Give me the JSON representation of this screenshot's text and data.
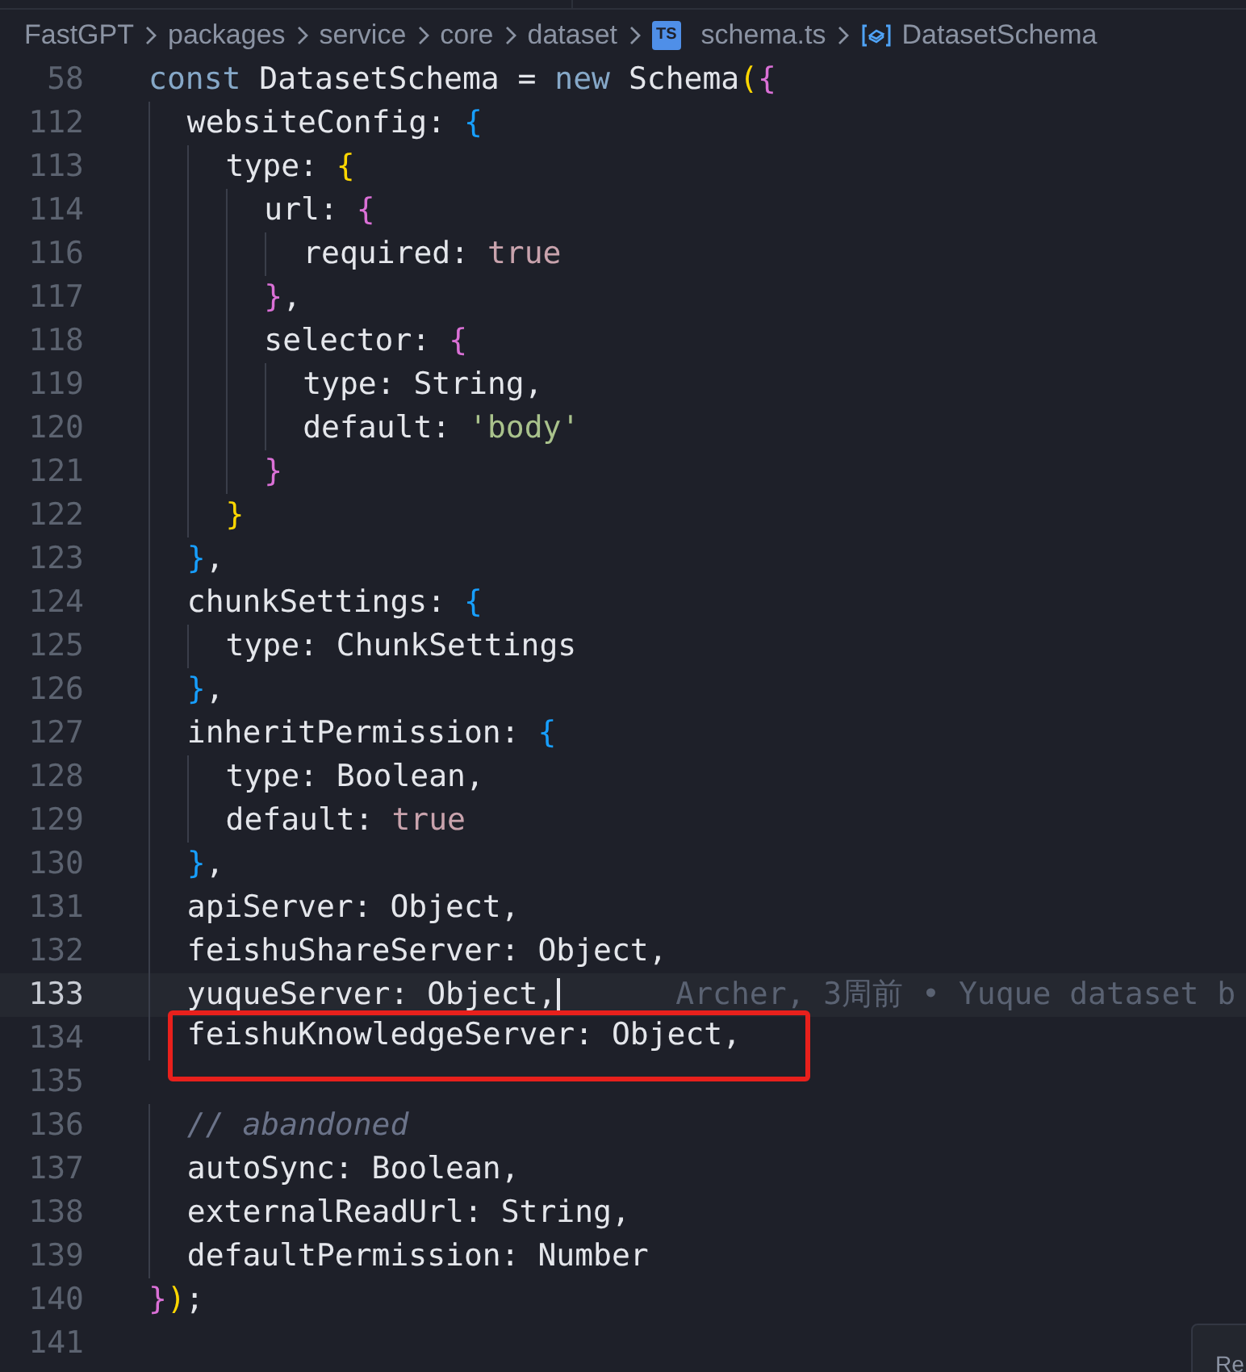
{
  "breadcrumb": [
    {
      "kind": "folder",
      "label": "FastGPT"
    },
    {
      "kind": "folder",
      "label": "packages"
    },
    {
      "kind": "folder",
      "label": "service"
    },
    {
      "kind": "folder",
      "label": "core"
    },
    {
      "kind": "folder",
      "label": "dataset"
    },
    {
      "kind": "file",
      "badge": "TS",
      "label": "schema.ts"
    },
    {
      "kind": "symbol",
      "label": "DatasetSchema"
    }
  ],
  "lines": [
    {
      "number": "58",
      "current": false,
      "highlighted": false,
      "tokens": [
        {
          "text": "const",
          "kind": "keyword"
        },
        {
          "text": " DatasetSchema = ",
          "kind": "plain"
        },
        {
          "text": "new",
          "kind": "keyword"
        },
        {
          "text": " Schema",
          "kind": "plain"
        },
        {
          "text": "(",
          "kind": "gold"
        },
        {
          "text": "{",
          "kind": "pink"
        }
      ]
    },
    {
      "number": "112",
      "current": false,
      "highlighted": false,
      "tokens": [
        {
          "text": "  websiteConfig: ",
          "kind": "plain"
        },
        {
          "text": "{",
          "kind": "blue"
        }
      ]
    },
    {
      "number": "113",
      "current": false,
      "highlighted": false,
      "tokens": [
        {
          "text": "    type: ",
          "kind": "plain"
        },
        {
          "text": "{",
          "kind": "gold"
        }
      ]
    },
    {
      "number": "114",
      "current": false,
      "highlighted": false,
      "tokens": [
        {
          "text": "      url: ",
          "kind": "plain"
        },
        {
          "text": "{",
          "kind": "pink"
        }
      ]
    },
    {
      "number": "116",
      "current": false,
      "highlighted": false,
      "tokens": [
        {
          "text": "        required: ",
          "kind": "plain"
        },
        {
          "text": "true",
          "kind": "literal"
        }
      ]
    },
    {
      "number": "117",
      "current": false,
      "highlighted": false,
      "tokens": [
        {
          "text": "      }",
          "kind": "pink"
        },
        {
          "text": ",",
          "kind": "plain"
        }
      ]
    },
    {
      "number": "118",
      "current": false,
      "highlighted": false,
      "tokens": [
        {
          "text": "      selector: ",
          "kind": "plain"
        },
        {
          "text": "{",
          "kind": "pink"
        }
      ]
    },
    {
      "number": "119",
      "current": false,
      "highlighted": false,
      "tokens": [
        {
          "text": "        type: String,",
          "kind": "plain"
        }
      ]
    },
    {
      "number": "120",
      "current": false,
      "highlighted": false,
      "tokens": [
        {
          "text": "        default: ",
          "kind": "plain"
        },
        {
          "text": "'body'",
          "kind": "string"
        }
      ]
    },
    {
      "number": "121",
      "current": false,
      "highlighted": false,
      "tokens": [
        {
          "text": "      }",
          "kind": "pink"
        }
      ]
    },
    {
      "number": "122",
      "current": false,
      "highlighted": false,
      "tokens": [
        {
          "text": "    }",
          "kind": "gold"
        }
      ]
    },
    {
      "number": "123",
      "current": false,
      "highlighted": false,
      "tokens": [
        {
          "text": "  }",
          "kind": "blue"
        },
        {
          "text": ",",
          "kind": "plain"
        }
      ]
    },
    {
      "number": "124",
      "current": false,
      "highlighted": false,
      "tokens": [
        {
          "text": "  chunkSettings: ",
          "kind": "plain"
        },
        {
          "text": "{",
          "kind": "blue"
        }
      ]
    },
    {
      "number": "125",
      "current": false,
      "highlighted": false,
      "tokens": [
        {
          "text": "    type: ChunkSettings",
          "kind": "plain"
        }
      ]
    },
    {
      "number": "126",
      "current": false,
      "highlighted": false,
      "tokens": [
        {
          "text": "  }",
          "kind": "blue"
        },
        {
          "text": ",",
          "kind": "plain"
        }
      ]
    },
    {
      "number": "127",
      "current": false,
      "highlighted": false,
      "tokens": [
        {
          "text": "  inheritPermission: ",
          "kind": "plain"
        },
        {
          "text": "{",
          "kind": "blue"
        }
      ]
    },
    {
      "number": "128",
      "current": false,
      "highlighted": false,
      "tokens": [
        {
          "text": "    type: Boolean,",
          "kind": "plain"
        }
      ]
    },
    {
      "number": "129",
      "current": false,
      "highlighted": false,
      "tokens": [
        {
          "text": "    default: ",
          "kind": "plain"
        },
        {
          "text": "true",
          "kind": "literal"
        }
      ]
    },
    {
      "number": "130",
      "current": false,
      "highlighted": false,
      "tokens": [
        {
          "text": "  }",
          "kind": "blue"
        },
        {
          "text": ",",
          "kind": "plain"
        }
      ]
    },
    {
      "number": "131",
      "current": false,
      "highlighted": false,
      "tokens": [
        {
          "text": "  apiServer: Object,",
          "kind": "plain"
        }
      ]
    },
    {
      "number": "132",
      "current": false,
      "highlighted": false,
      "tokens": [
        {
          "text": "  feishuShareServer: Object,",
          "kind": "plain"
        }
      ]
    },
    {
      "number": "133",
      "current": true,
      "highlighted": false,
      "blame": "Archer, 3周前 • Yuque dataset b",
      "tokens": [
        {
          "text": "  yuqueServer: Object,",
          "kind": "plain"
        }
      ]
    },
    {
      "number": "134",
      "current": false,
      "highlighted": true,
      "tokens": [
        {
          "text": "  feishuKnowledgeServer: Object,",
          "kind": "plain"
        }
      ]
    },
    {
      "number": "135",
      "current": false
    },
    {
      "number": "136",
      "current": false,
      "highlighted": false,
      "tokens": [
        {
          "text": "  // abandoned",
          "kind": "comment"
        }
      ]
    },
    {
      "number": "137",
      "current": false,
      "highlighted": false,
      "tokens": [
        {
          "text": "  autoSync: Boolean,",
          "kind": "plain"
        }
      ]
    },
    {
      "number": "138",
      "current": false,
      "highlighted": false,
      "tokens": [
        {
          "text": "  externalReadUrl: String,",
          "kind": "plain"
        }
      ]
    },
    {
      "number": "139",
      "current": false,
      "highlighted": false,
      "tokens": [
        {
          "text": "  defaultPermission: Number",
          "kind": "plain"
        }
      ]
    },
    {
      "number": "140",
      "current": false,
      "highlighted": false,
      "tokens": [
        {
          "text": "}",
          "kind": "pink"
        },
        {
          "text": ")",
          "kind": "gold"
        },
        {
          "text": ";",
          "kind": "plain"
        }
      ]
    },
    {
      "number": "141",
      "current": false
    }
  ],
  "corner_popup": "Re"
}
